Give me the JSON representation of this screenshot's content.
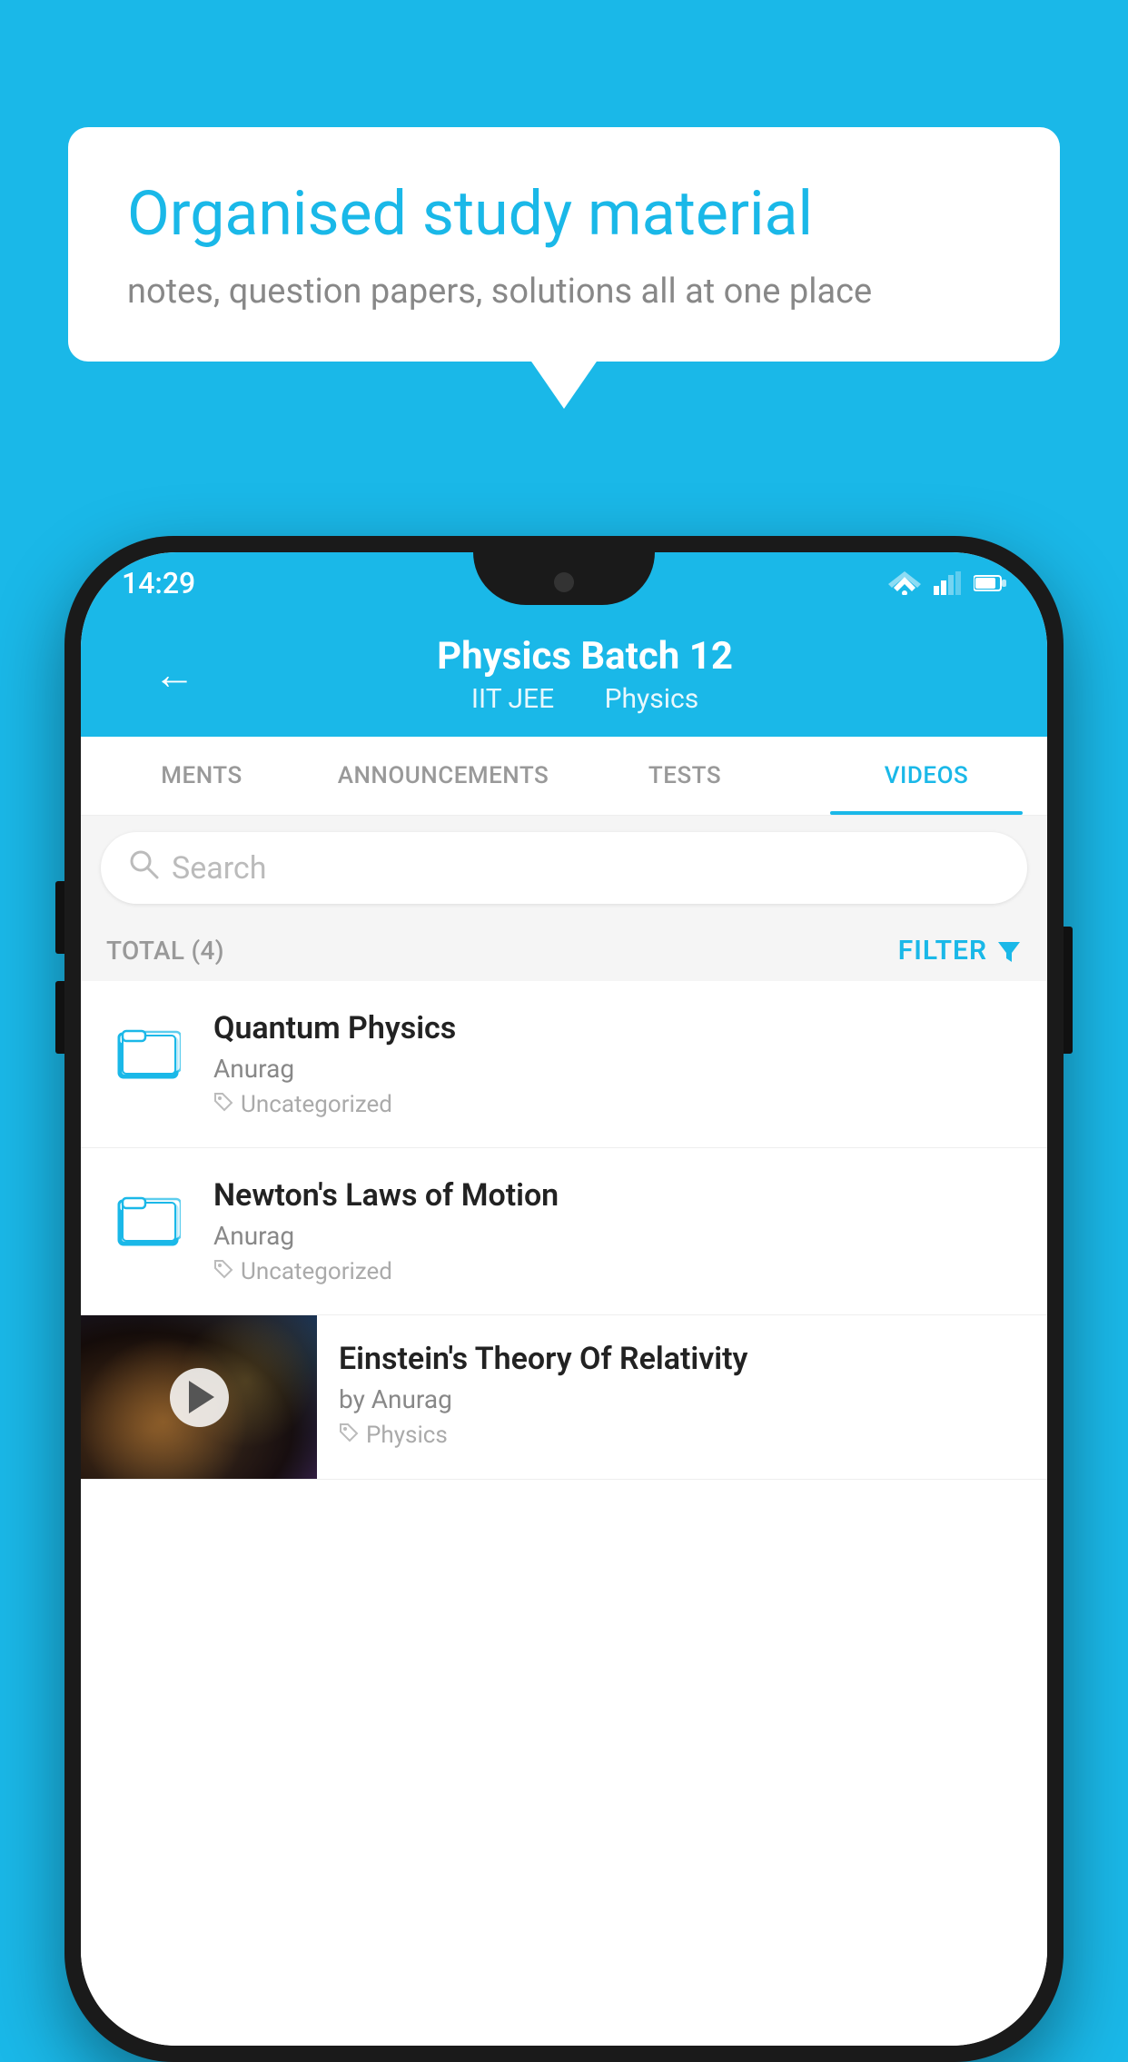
{
  "background_color": "#1ab8e8",
  "speech_bubble": {
    "title": "Organised study material",
    "subtitle": "notes, question papers, solutions all at one place"
  },
  "status_bar": {
    "time": "14:29"
  },
  "header": {
    "back_label": "←",
    "title": "Physics Batch 12",
    "subtitle_part1": "IIT JEE",
    "subtitle_part2": "Physics"
  },
  "tabs": [
    {
      "label": "MENTS",
      "active": false
    },
    {
      "label": "ANNOUNCEMENTS",
      "active": false
    },
    {
      "label": "TESTS",
      "active": false
    },
    {
      "label": "VIDEOS",
      "active": true
    }
  ],
  "search": {
    "placeholder": "Search"
  },
  "filter": {
    "total_label": "TOTAL (4)",
    "button_label": "FILTER"
  },
  "videos": [
    {
      "title": "Quantum Physics",
      "author": "Anurag",
      "tag": "Uncategorized",
      "has_thumbnail": false
    },
    {
      "title": "Newton's Laws of Motion",
      "author": "Anurag",
      "tag": "Uncategorized",
      "has_thumbnail": false
    },
    {
      "title": "Einstein's Theory Of Relativity",
      "author": "by Anurag",
      "tag": "Physics",
      "has_thumbnail": true
    }
  ],
  "icons": {
    "folder": "folder-icon",
    "tag": "🏷",
    "filter_funnel": "▼",
    "search": "🔍"
  }
}
